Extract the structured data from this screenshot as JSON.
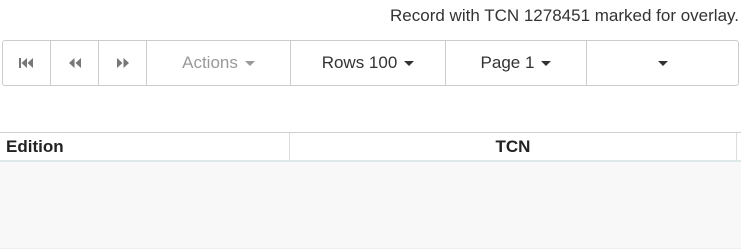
{
  "status_message": "Record with TCN 1278451 marked for overlay.",
  "toolbar": {
    "first_page_icon": "first-page-icon",
    "prev_page_icon": "previous-page-icon",
    "next_page_icon": "next-page-icon",
    "actions_label": "Actions",
    "rows_label": "Rows 100",
    "page_label": "Page 1"
  },
  "grid": {
    "columns": [
      "Edition",
      "TCN"
    ]
  },
  "colors": {
    "border": "#cccccc",
    "disabled_text": "#999999",
    "grid_body": "#f8f8f8"
  }
}
